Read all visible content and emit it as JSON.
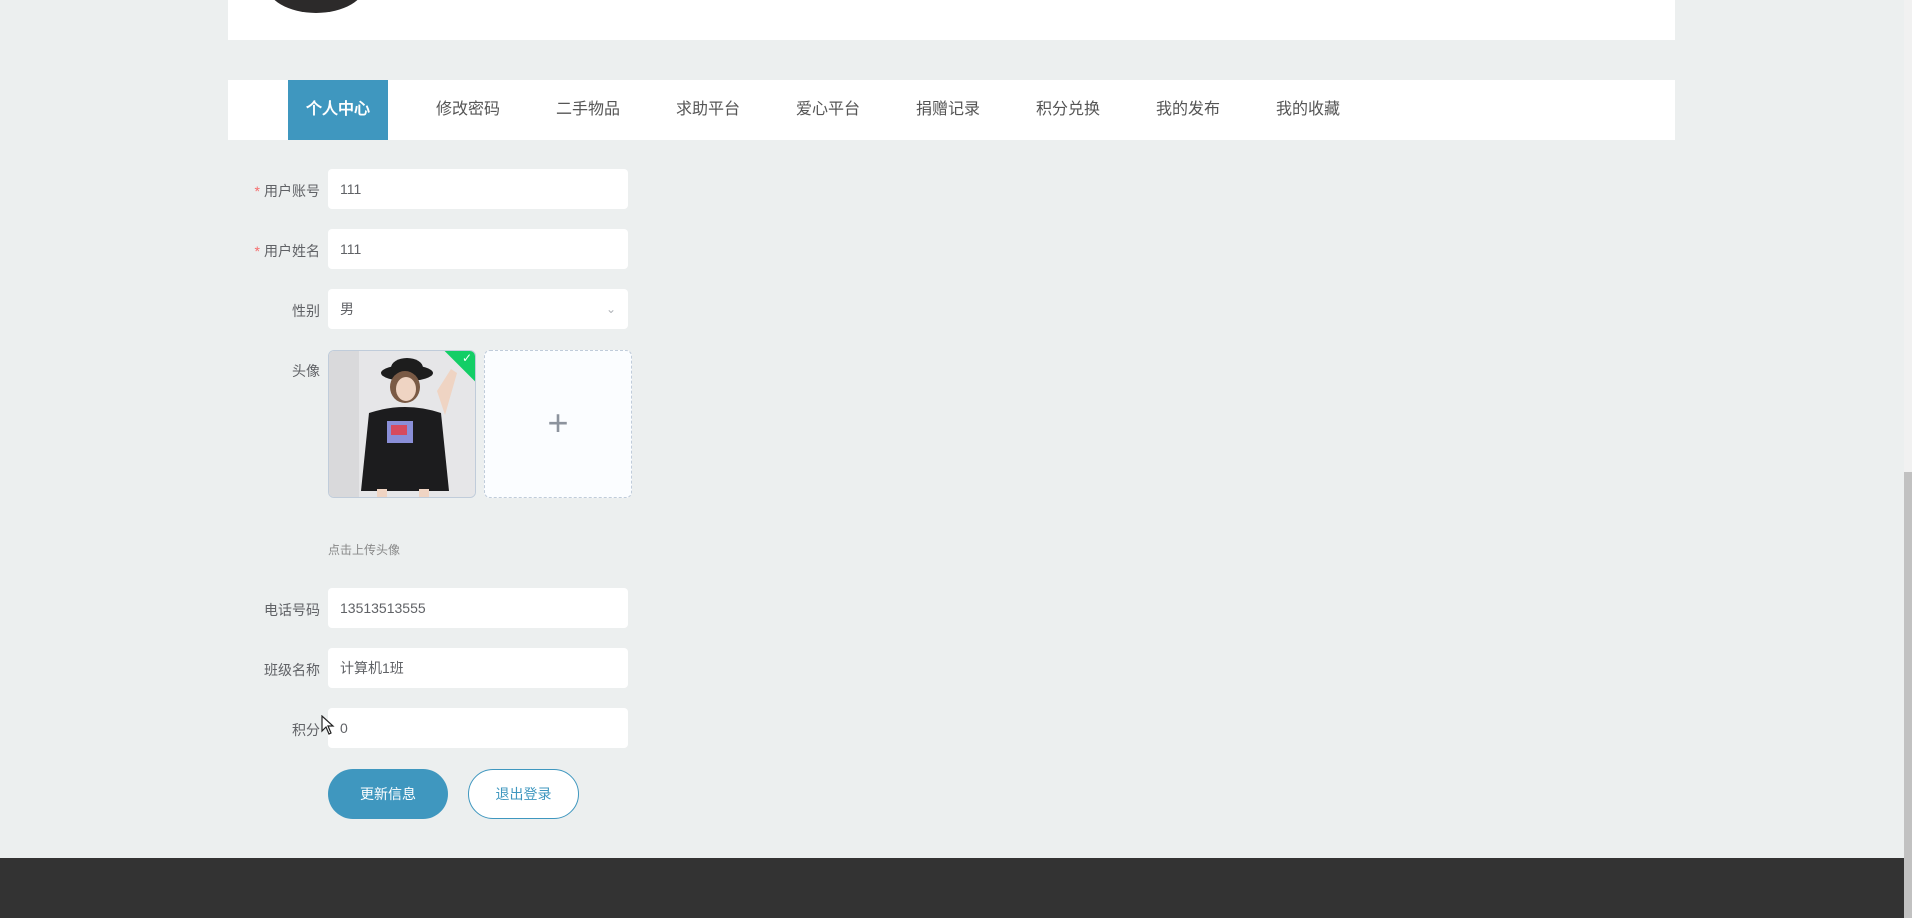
{
  "nav": {
    "items": [
      {
        "label": "个人中心",
        "active": true
      },
      {
        "label": "修改密码",
        "active": false
      },
      {
        "label": "二手物品",
        "active": false
      },
      {
        "label": "求助平台",
        "active": false
      },
      {
        "label": "爱心平台",
        "active": false
      },
      {
        "label": "捐赠记录",
        "active": false
      },
      {
        "label": "积分兑换",
        "active": false
      },
      {
        "label": "我的发布",
        "active": false
      },
      {
        "label": "我的收藏",
        "active": false
      }
    ]
  },
  "form": {
    "account": {
      "label": "用户账号",
      "required_mark": "*",
      "value": "111"
    },
    "name": {
      "label": "用户姓名",
      "required_mark": "*",
      "value": "111"
    },
    "gender": {
      "label": "性别",
      "value": "男"
    },
    "avatar": {
      "label": "头像",
      "hint": "点击上传头像"
    },
    "phone": {
      "label": "电话号码",
      "value": "13513513555"
    },
    "class": {
      "label": "班级名称",
      "value": "计算机1班"
    },
    "points": {
      "label": "积分",
      "value": "0"
    }
  },
  "buttons": {
    "update": "更新信息",
    "logout": "退出登录"
  },
  "colors": {
    "accent": "#3f97bf",
    "success": "#13ce66",
    "required": "#f56c6c",
    "footer": "#333333"
  }
}
